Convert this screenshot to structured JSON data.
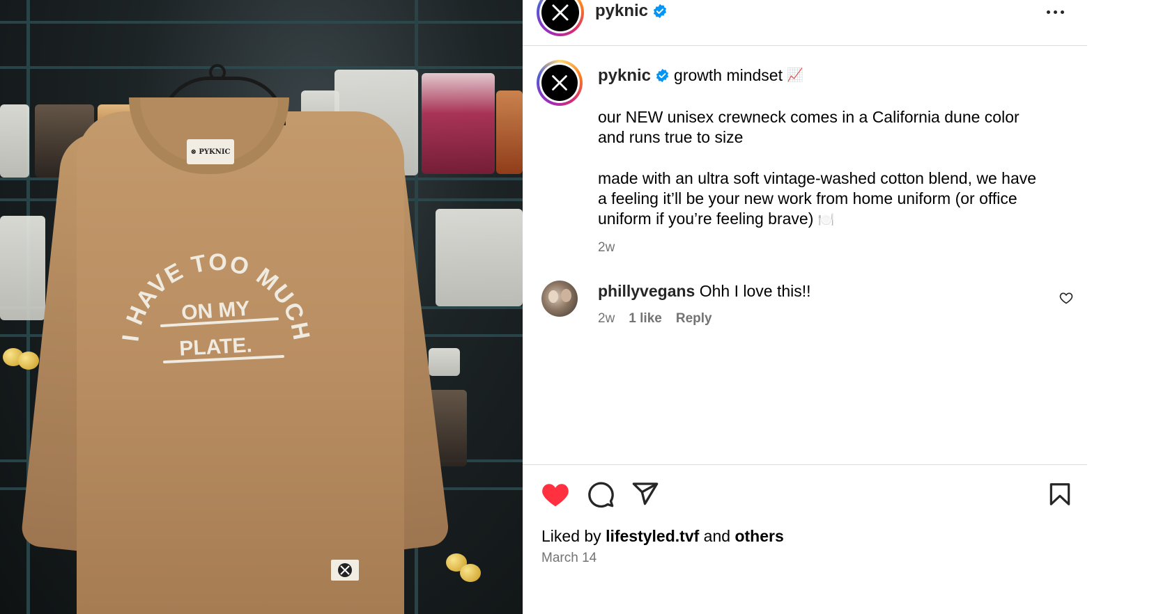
{
  "post": {
    "author": "pyknic",
    "verified": true,
    "caption_lead": "growth mindset",
    "caption_lead_emoji": "📈",
    "caption_paragraph_1": [
      "our NEW unisex crewneck comes in a California dune color",
      "and runs true to size"
    ],
    "caption_paragraph_2": [
      "made with an ultra soft vintage-washed cotton blend, we have",
      "a feeling it’ll be your new work from home uniform (or office",
      "uniform if you’re feeling brave)"
    ],
    "caption_end_emoji": "🍽️",
    "caption_age": "2w",
    "date": "March 14",
    "likes": {
      "prefix": "Liked by",
      "user": "lifestyled.tvf",
      "middle": "and",
      "suffix": "others"
    }
  },
  "photo": {
    "tag_text": "⊗ PYKNIC",
    "graphic_top": "I HAVE TOO MUCH",
    "graphic_middle": "ON MY",
    "graphic_bottom": "PLATE."
  },
  "comment": {
    "user": "phillyvegans",
    "text": "Ohh I love this!!",
    "age": "2w",
    "likes": "1 like",
    "reply": "Reply"
  },
  "actions": {
    "more": "more-options",
    "like": "heart-filled",
    "comment": "comment",
    "share": "share",
    "save": "bookmark"
  },
  "colors": {
    "like_red": "#ff3040",
    "verified_blue": "#0095f6",
    "meta_gray": "#737373",
    "sweater": "#b98e62"
  }
}
